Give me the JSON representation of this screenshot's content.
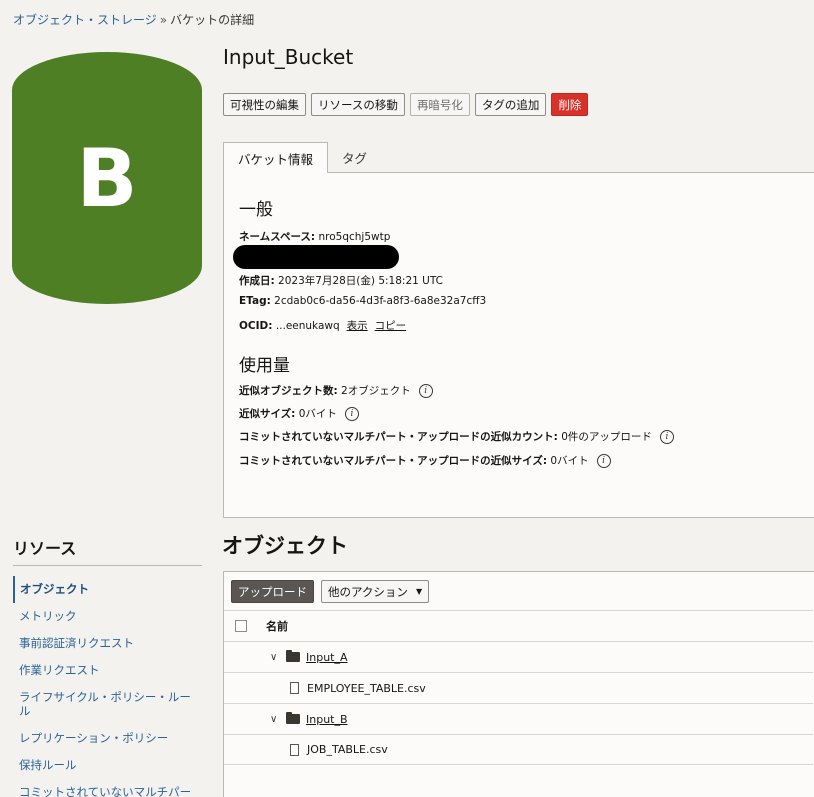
{
  "breadcrumb": {
    "root": "オブジェクト・ストレージ",
    "separator": "»",
    "current": "バケットの詳細"
  },
  "bucket": {
    "initial": "B",
    "name": "Input_Bucket",
    "color": "#4e7f24"
  },
  "actions": {
    "edit_visibility": "可視性の編集",
    "move_resource": "リソースの移動",
    "re_encrypt": "再暗号化",
    "add_tags": "タグの追加",
    "delete": "削除"
  },
  "tabs": {
    "bucket_info": "バケット情報",
    "tags": "タグ"
  },
  "general": {
    "heading": "一般",
    "namespace_label": "ネームスペース:",
    "namespace_value": "nro5qchj5wtp",
    "created_label": "作成日:",
    "created_value": "2023年7月28日(金) 5:18:21 UTC",
    "etag_label": "ETag:",
    "etag_value": "2cdab0c6-da56-4d3f-a8f3-6a8e32a7cff3",
    "ocid_label": "OCID:",
    "ocid_value": "...eenukawq",
    "ocid_show": "表示",
    "ocid_copy": "コピー"
  },
  "usage": {
    "heading": "使用量",
    "obj_count_label": "近似オブジェクト数:",
    "obj_count_value": "2オブジェクト",
    "size_label": "近似サイズ:",
    "size_value": "0バイト",
    "mp_count_label": "コミットされていないマルチパート・アップロードの近似カウント:",
    "mp_count_value": "0件のアップロード",
    "mp_size_label": "コミットされていないマルチパート・アップロードの近似サイズ:",
    "mp_size_value": "0バイト",
    "info_glyph": "i"
  },
  "resources": {
    "title": "リソース",
    "items": [
      "オブジェクト",
      "メトリック",
      "事前認証済リクエスト",
      "作業リクエスト",
      "ライフサイクル・ポリシー・ルール",
      "レプリケーション・ポリシー",
      "保持ルール",
      "コミットされていないマルチパー"
    ]
  },
  "objects": {
    "title": "オブジェクト",
    "upload_button": "アップロード",
    "more_actions": "他のアクション",
    "column_name": "名前",
    "rows": [
      {
        "type": "folder",
        "name": "Input_A"
      },
      {
        "type": "file",
        "name": "EMPLOYEE_TABLE.csv"
      },
      {
        "type": "folder",
        "name": "Input_B"
      },
      {
        "type": "file",
        "name": "JOB_TABLE.csv"
      }
    ]
  }
}
